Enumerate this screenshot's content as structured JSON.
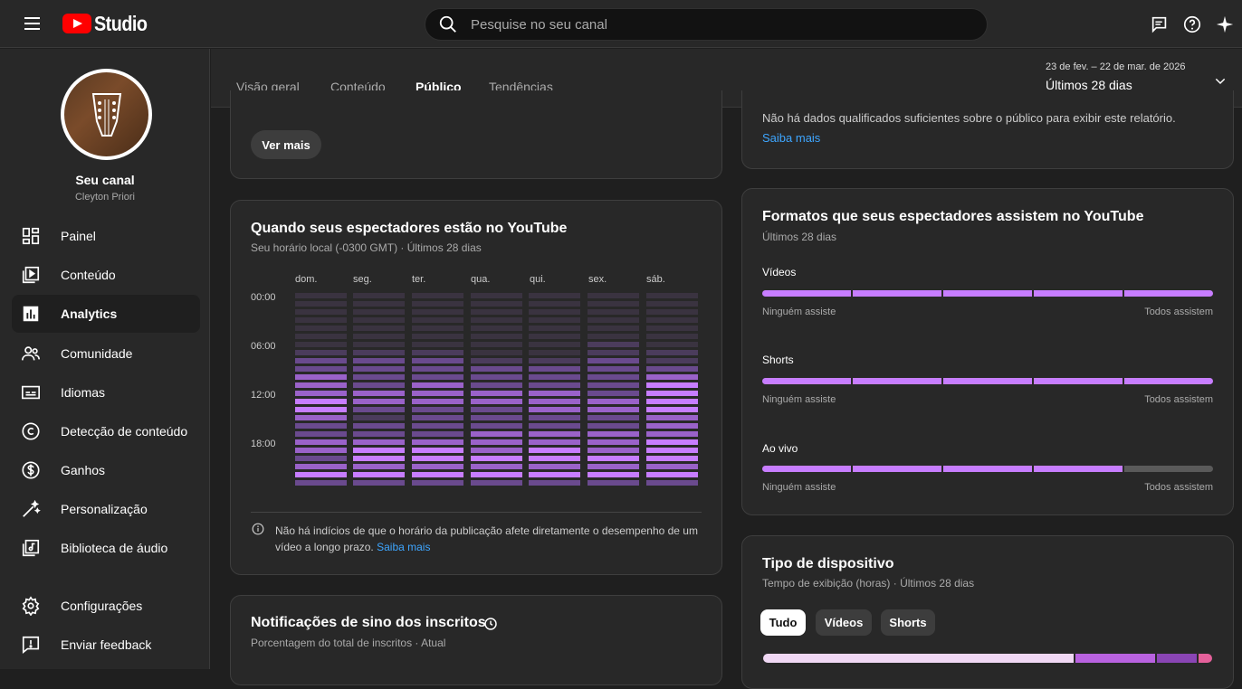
{
  "header": {
    "logo_text": "Studio",
    "search_placeholder": "Pesquise no seu canal"
  },
  "channel": {
    "name": "Seu canal",
    "handle": "Cleyton Priori"
  },
  "sidebar": {
    "items": [
      {
        "label": "Painel",
        "icon": "dashboard-icon"
      },
      {
        "label": "Conteúdo",
        "icon": "content-icon"
      },
      {
        "label": "Analytics",
        "icon": "analytics-icon",
        "active": true
      },
      {
        "label": "Comunidade",
        "icon": "community-icon"
      },
      {
        "label": "Idiomas",
        "icon": "subtitles-icon"
      },
      {
        "label": "Detecção de conteúdo",
        "icon": "copyright-icon"
      },
      {
        "label": "Ganhos",
        "icon": "dollar-icon"
      },
      {
        "label": "Personalização",
        "icon": "magic-wand-icon"
      },
      {
        "label": "Biblioteca de áudio",
        "icon": "audio-library-icon"
      }
    ],
    "settings_label": "Configurações",
    "feedback_label": "Enviar feedback"
  },
  "tabs": [
    "Visão geral",
    "Conteúdo",
    "Público",
    "Tendências"
  ],
  "active_tab": "Público",
  "date_range": {
    "dates": "23 de fev. – 22 de mar. de 2026",
    "label": "Últimos 28 dias"
  },
  "top_left_card": {
    "button": "Ver mais"
  },
  "top_right_card": {
    "message": "Não há dados qualificados suficientes sobre o público para exibir este relatório.",
    "link": "Saiba mais"
  },
  "when_card": {
    "title": "Quando seus espectadores estão no YouTube",
    "subtitle": "Seu horário local (-0300 GMT) · Últimos 28 dias",
    "days": [
      "dom.",
      "seg.",
      "ter.",
      "qua.",
      "qui.",
      "sex.",
      "sáb."
    ],
    "hours": [
      "00:00",
      "06:00",
      "12:00",
      "18:00"
    ],
    "footnote": "Não há indícios de que o horário da publicação afete diretamente o desempenho de um vídeo a longo prazo.",
    "footnote_link": "Saiba mais",
    "activity_levels": [
      [
        0,
        0,
        0,
        0,
        0,
        0,
        0,
        1,
        2,
        2,
        3,
        3,
        3,
        4,
        4,
        3,
        2,
        2,
        3,
        3,
        2,
        3,
        4,
        2
      ],
      [
        0,
        0,
        0,
        0,
        0,
        0,
        0,
        1,
        2,
        2,
        2,
        2,
        3,
        3,
        2,
        1,
        2,
        2,
        3,
        4,
        4,
        3,
        4,
        2
      ],
      [
        0,
        0,
        0,
        0,
        0,
        0,
        0,
        1,
        2,
        2,
        2,
        3,
        3,
        3,
        2,
        2,
        2,
        2,
        3,
        4,
        4,
        3,
        4,
        2
      ],
      [
        0,
        0,
        0,
        0,
        0,
        0,
        0,
        0,
        1,
        2,
        2,
        2,
        3,
        3,
        2,
        2,
        2,
        3,
        3,
        3,
        4,
        3,
        4,
        2
      ],
      [
        0,
        0,
        0,
        0,
        0,
        0,
        0,
        0,
        1,
        2,
        2,
        2,
        3,
        3,
        3,
        2,
        2,
        3,
        3,
        4,
        4,
        3,
        4,
        2
      ],
      [
        0,
        0,
        0,
        0,
        0,
        0,
        1,
        1,
        2,
        2,
        2,
        2,
        2,
        3,
        3,
        2,
        2,
        3,
        3,
        3,
        4,
        3,
        4,
        2
      ],
      [
        0,
        0,
        0,
        0,
        0,
        0,
        0,
        1,
        1,
        2,
        3,
        4,
        4,
        4,
        4,
        3,
        3,
        3,
        4,
        4,
        4,
        3,
        4,
        2
      ]
    ]
  },
  "bell_card": {
    "title": "Notificações de sino dos inscritos",
    "subtitle": "Porcentagem do total de inscritos · Atual"
  },
  "formats_card": {
    "title": "Formatos que seus espectadores assistem no YouTube",
    "subtitle": "Últimos 28 dias",
    "scale_low": "Ninguém assiste",
    "scale_high": "Todos assistem",
    "formats": [
      {
        "name": "Vídeos",
        "level": 5
      },
      {
        "name": "Shorts",
        "level": 5
      },
      {
        "name": "Ao vivo",
        "level": 4
      }
    ]
  },
  "device_card": {
    "title": "Tipo de dispositivo",
    "subtitle": "Tempo de exibição (horas) · Últimos 28 dias",
    "chips": [
      "Tudo",
      "Vídeos",
      "Shorts"
    ],
    "active_chip": "Tudo",
    "shares": [
      0.7,
      0.18,
      0.09,
      0.03
    ]
  },
  "colors": {
    "accent": "#c77dff",
    "heat": [
      "#3a3340",
      "#4b3c5c",
      "#6a4a8e",
      "#9a62c9",
      "#c77dff"
    ],
    "device": [
      "#f0d8f4",
      "#b962e0",
      "#8a45b5",
      "#e4609a"
    ]
  }
}
